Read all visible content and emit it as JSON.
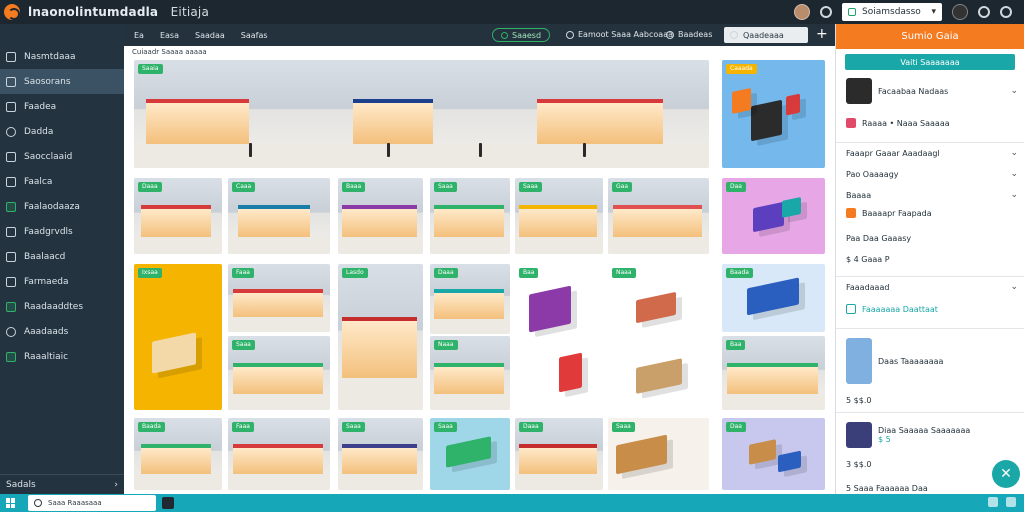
{
  "app": {
    "title": "lnaonolintumdadla",
    "subtitle": "Eitiaja"
  },
  "topbar": {
    "store_select": "Soiamsdasso"
  },
  "sidebar": {
    "items": [
      {
        "label": "Nasmtdaaa",
        "icon": "dashboard-icon"
      },
      {
        "label": "Saosorans",
        "icon": "store-icon"
      },
      {
        "label": "Faadea",
        "icon": "list-icon"
      },
      {
        "label": "Dadda",
        "icon": "clock-icon"
      },
      {
        "label": "Saocclaaid",
        "icon": "chart-icon"
      },
      {
        "label": "Faalca",
        "icon": "folder-icon"
      },
      {
        "label": "Faalaodaaza",
        "icon": "box-icon"
      },
      {
        "label": "Faadgrvdls",
        "icon": "grid-icon"
      },
      {
        "label": "Baalaacd",
        "icon": "list-icon"
      },
      {
        "label": "Farmaeda",
        "icon": "clock-icon"
      },
      {
        "label": "Raadaaddtes",
        "icon": "tag-icon"
      },
      {
        "label": "Aaadaads",
        "icon": "info-icon"
      },
      {
        "label": "Raaaltiaic",
        "icon": "check-icon"
      }
    ],
    "footer": "Sadals"
  },
  "toolbar": {
    "items": [
      "Ea",
      "Easa",
      "Saadaa",
      "Saafas"
    ],
    "pill": "Saaesd",
    "action1": "Eamoot Saaa Aabcoaaa",
    "action2": "Baadeas",
    "search_placeholder": "Qaadeaaa"
  },
  "breadcrumb": "Cuiaadr Saaaa aaaaa",
  "tiles": [
    {
      "badge": "Saaia"
    },
    {
      "badge": "Caaada"
    },
    {
      "badge": "Daaa"
    },
    {
      "badge": "Caaa"
    },
    {
      "badge": "Baaa"
    },
    {
      "badge": "Saaa"
    },
    {
      "badge": "Saaa"
    },
    {
      "badge": "Gaa"
    },
    {
      "badge": "Daa"
    },
    {
      "badge": "Ixsaa"
    },
    {
      "badge": "Faaa"
    },
    {
      "badge": "Lasdo"
    },
    {
      "badge": "Daaa"
    },
    {
      "badge": "Baa"
    },
    {
      "badge": "Naaa"
    },
    {
      "badge": "Baada"
    },
    {
      "badge": "Saaa"
    },
    {
      "badge": "Naaa"
    },
    {
      "badge": "Baa"
    },
    {
      "badge": "Baada"
    },
    {
      "badge": "Faaa"
    },
    {
      "badge": "Saaa"
    },
    {
      "badge": "Saaa"
    },
    {
      "badge": "Daaa"
    },
    {
      "badge": "Saaa"
    },
    {
      "badge": "Daa"
    }
  ],
  "panel": {
    "title": "Sumio Gaia",
    "button": "Vaiti Saaaaaaa",
    "product_title": "Facaabaa Nadaas",
    "product_note": "Raaaa • Naaa Saaaaa",
    "rows": [
      "Faaapr Gaaar Aaadaagl",
      "Pao Oaaaagy",
      "Baaaa",
      "Baaaapr Faapada",
      "Paa Daa Gaaasy"
    ],
    "price": "$ 4 Gaaa P",
    "section": "Faaadaaad",
    "section_link": "Faaaaaaa Daattaat",
    "item1_title": "Daas Taaaaaaaa",
    "item1_price": "5 $$.0",
    "item2_title": "Diaa Saaaaa Saaaaaaa",
    "item2_sub": "$ 5",
    "item2_price": "3 $$.0",
    "footer": "5 Saaa Faaaaaa Daa"
  },
  "taskbar": {
    "search_placeholder": "Saaa Raaasaaa"
  }
}
